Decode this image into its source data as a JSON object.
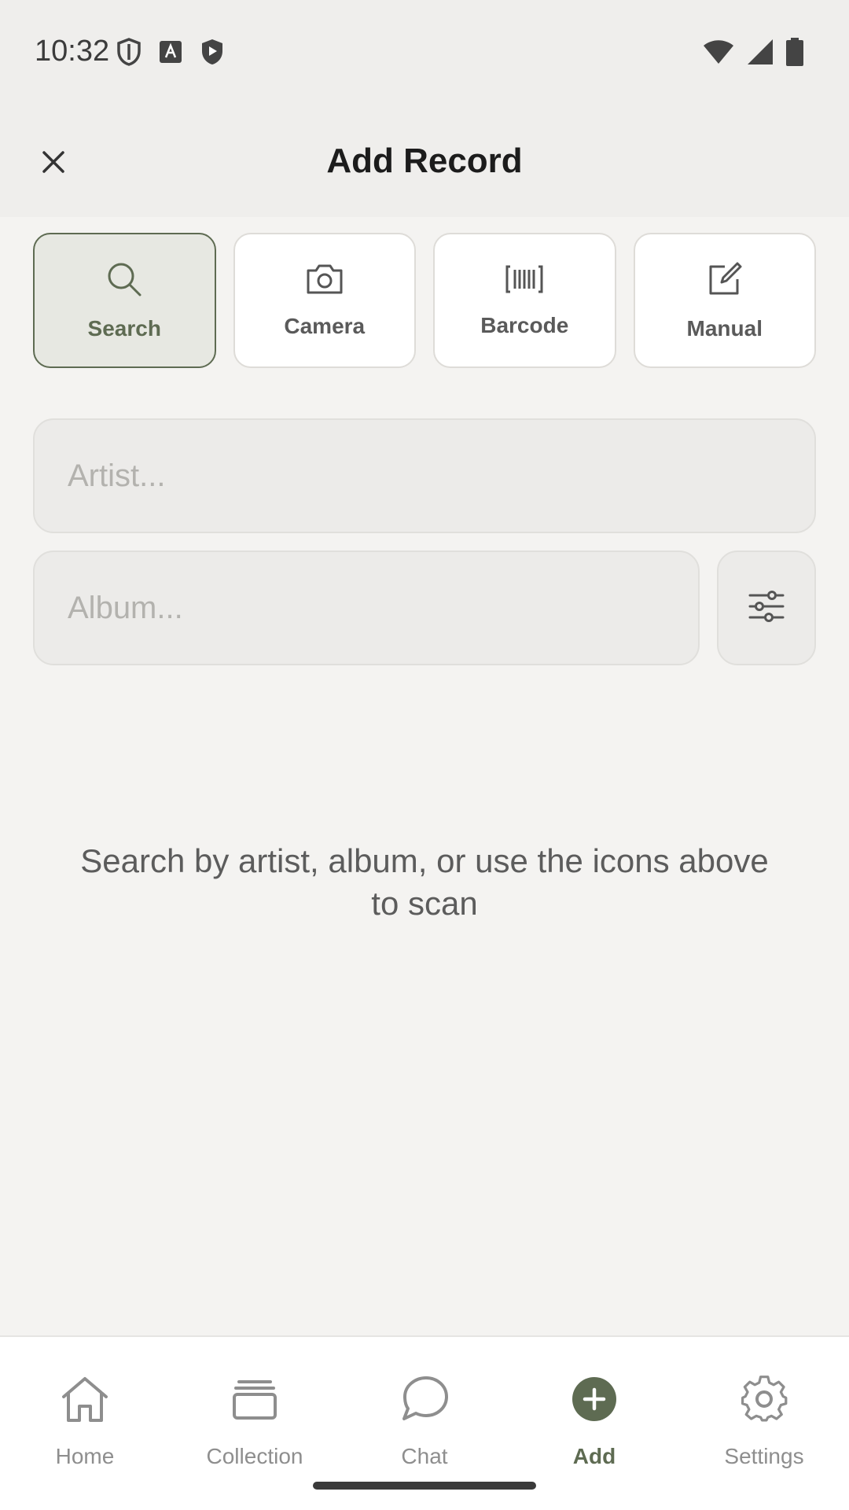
{
  "status_bar": {
    "time": "10:32",
    "icons_left": [
      "shield-outline-icon",
      "keyboard-a-icon",
      "play-shield-icon"
    ],
    "icons_right": [
      "wifi-icon",
      "signal-icon",
      "battery-icon"
    ]
  },
  "app_bar": {
    "title": "Add Record",
    "close_icon": "close-icon"
  },
  "modes": [
    {
      "label": "Search",
      "icon": "search-icon",
      "active": true
    },
    {
      "label": "Camera",
      "icon": "camera-icon",
      "active": false
    },
    {
      "label": "Barcode",
      "icon": "barcode-icon",
      "active": false
    },
    {
      "label": "Manual",
      "icon": "edit-icon",
      "active": false
    }
  ],
  "form": {
    "artist_placeholder": "Artist...",
    "artist_value": "",
    "album_placeholder": "Album...",
    "album_value": "",
    "filter_icon": "sliders-icon"
  },
  "hint": "Search by artist, album, or use the icons above to scan",
  "nav": {
    "items": [
      {
        "label": "Home",
        "icon": "home-icon",
        "active": false
      },
      {
        "label": "Collection",
        "icon": "collection-icon",
        "active": false
      },
      {
        "label": "Chat",
        "icon": "chat-icon",
        "active": false
      },
      {
        "label": "Add",
        "icon": "add-circle-icon",
        "active": true
      },
      {
        "label": "Settings",
        "icon": "settings-icon",
        "active": false
      }
    ]
  },
  "colors": {
    "accent": "#5e6b52",
    "background": "#f4f3f1",
    "app_bar": "#efeeec",
    "muted_text": "#8e8e8e"
  }
}
